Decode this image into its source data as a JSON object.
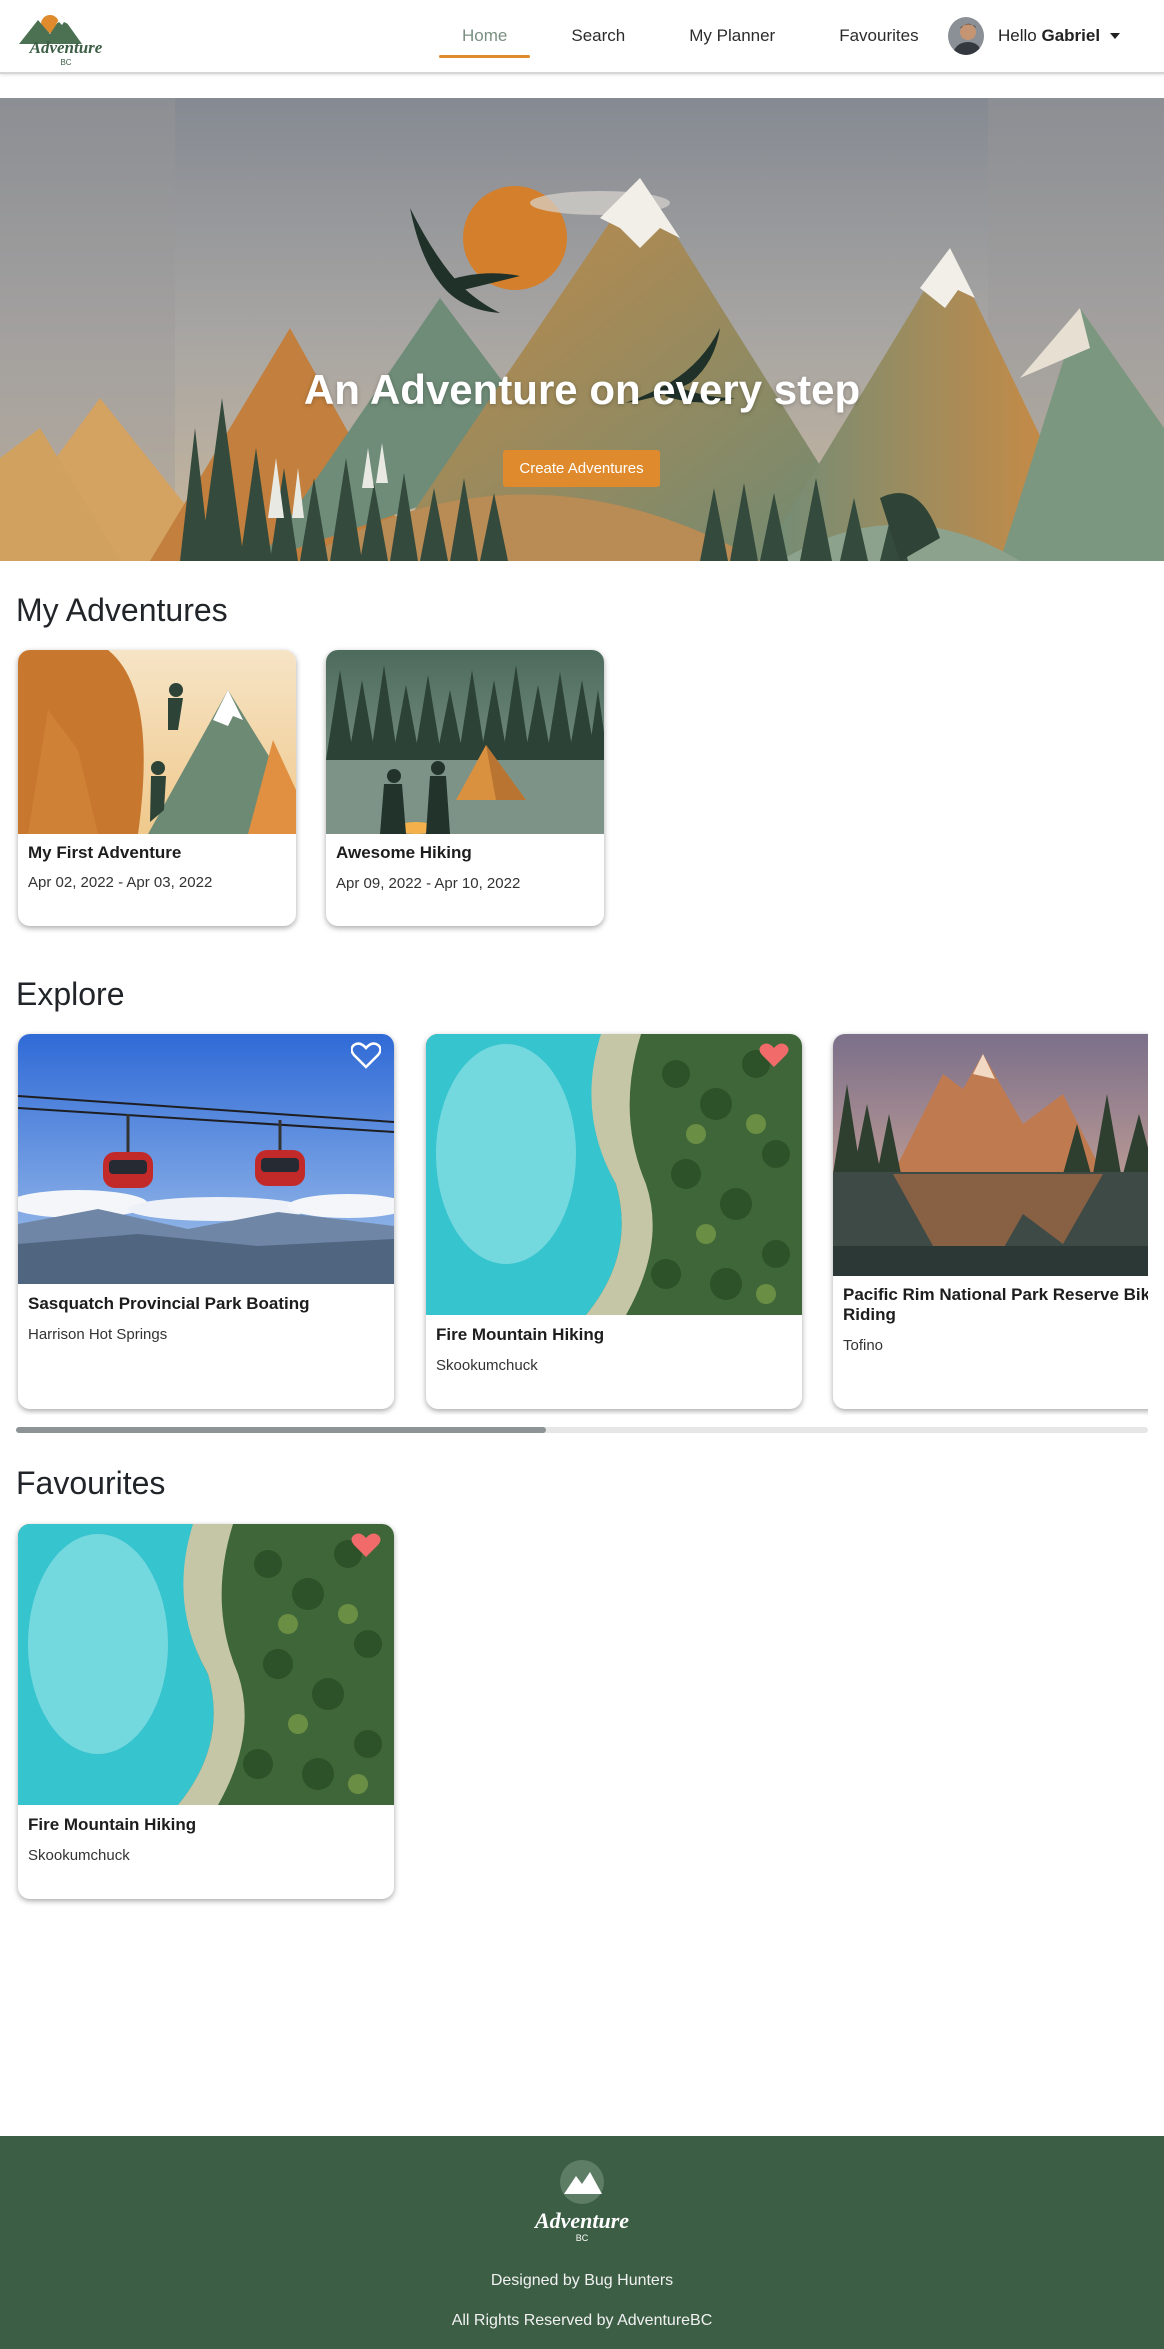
{
  "nav": {
    "logo_text": "Adventure",
    "logo_sub": "BC",
    "links": [
      {
        "label": "Home",
        "active": true
      },
      {
        "label": "Search",
        "active": false
      },
      {
        "label": "My Planner",
        "active": false
      },
      {
        "label": "Favourites",
        "active": false
      }
    ],
    "greeting": "Hello",
    "user_name": "Gabriel"
  },
  "hero": {
    "title": "An Adventure on every step",
    "button_label": "Create Adventures"
  },
  "my_adventures": {
    "heading": "My Adventures",
    "cards": [
      {
        "title": "My First Adventure",
        "dates": "Apr 02, 2022 - Apr 03, 2022"
      },
      {
        "title": "Awesome Hiking",
        "dates": "Apr 09, 2022 - Apr 10, 2022"
      }
    ]
  },
  "explore": {
    "heading": "Explore",
    "cards": [
      {
        "title": "Sasquatch Provincial Park Boating",
        "location": "Harrison Hot Springs",
        "favourited": false
      },
      {
        "title": "Fire Mountain Hiking",
        "location": "Skookumchuck",
        "favourited": true
      },
      {
        "title": "Pacific Rim National Park Reserve Bike Riding",
        "location": "Tofino",
        "favourited": false
      }
    ]
  },
  "favourites": {
    "heading": "Favourites",
    "cards": [
      {
        "title": "Fire Mountain Hiking",
        "location": "Skookumchuck",
        "favourited": true
      }
    ]
  },
  "footer": {
    "logo_text": "Adventure",
    "logo_sub": "BC",
    "designed_by": "Designed by Bug Hunters",
    "rights": "All Rights Reserved by AdventureBC"
  },
  "colors": {
    "accent": "#df8a2c",
    "nav_active": "#7a8f80",
    "footer_bg": "#3c5e45",
    "heart_filled": "#f26b6b"
  },
  "icons": [
    "logo-icon",
    "avatar",
    "heart-outline-icon",
    "heart-filled-icon",
    "caret-down-icon"
  ]
}
